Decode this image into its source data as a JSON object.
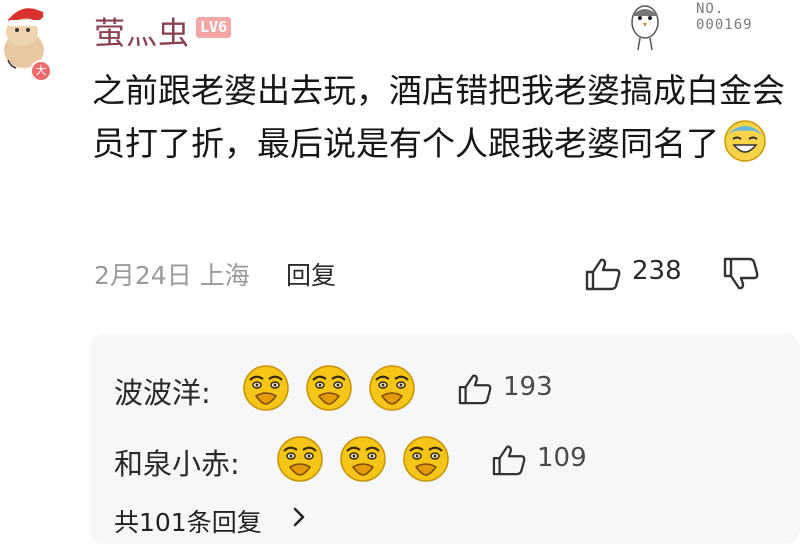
{
  "comment": {
    "username": "萤灬虫",
    "level_badge": "LV6",
    "avatar_badge": "大",
    "medal_no": "NO.",
    "medal_number": "000169",
    "text": "之前跟老婆出去玩，酒店错把我老婆搞成白金会员打了折，最后说是有个人跟我老婆同名了",
    "emoji": "laughing-face-icon",
    "date_location": "2月24日 上海",
    "reply_label": "回复",
    "like_count": "238"
  },
  "replies": [
    {
      "user": "波波洋:",
      "emoji": "funny-face-icon",
      "emoji_count": 3,
      "likes": "193"
    },
    {
      "user": "和泉小赤:",
      "emoji": "funny-face-icon",
      "emoji_count": 3,
      "likes": "109"
    }
  ],
  "more_replies": "共101条回复",
  "colors": {
    "username": "#8a3f52",
    "level_badge": "#f3a7a7",
    "reply_bg": "#f6f7f9",
    "emoji_yellow": "#f5c518"
  }
}
